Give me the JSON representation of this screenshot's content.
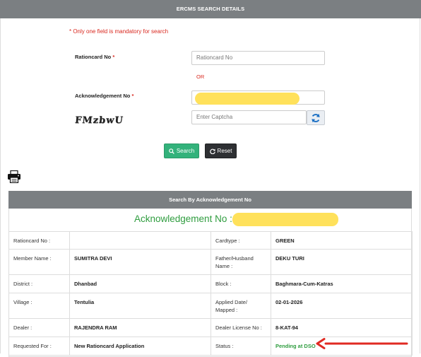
{
  "header": {
    "title": "ERCMS SEARCH DETAILS"
  },
  "form": {
    "mandatory_note": "* Only one field is mandatory for search",
    "rationcard_label": "Rationcard No",
    "rationcard_placeholder": "Rationcard No",
    "or_text": "OR",
    "ack_label": "Acknowledgement No",
    "captcha_text": "FMzbwU",
    "captcha_placeholder": "Enter Captcha",
    "required_mark": "*"
  },
  "buttons": {
    "search_label": "Search",
    "reset_label": "Reset"
  },
  "result": {
    "header": "Search By Acknowledgement No",
    "ack_title": "Acknowledgement No :",
    "rows": [
      {
        "l1": "Rationcard No :",
        "v1": "",
        "l2": "Cardtype :",
        "v2": "GREEN"
      },
      {
        "l1": "Member Name :",
        "v1": "SUMITRA DEVI",
        "l2": "Father/Husband Name :",
        "v2": "DEKU TURI"
      },
      {
        "l1": "District :",
        "v1": "Dhanbad",
        "l2": "Block :",
        "v2": "Baghmara-Cum-Katras"
      },
      {
        "l1": "Village :",
        "v1": "Tentulia",
        "l2": "Applied Date/ Mapped :",
        "v2": "02-01-2026"
      },
      {
        "l1": "Dealer :",
        "v1": "RAJENDRA RAM",
        "l2": "Dealer License No :",
        "v2": "8-KAT-94"
      },
      {
        "l1": "Requested For :",
        "v1": "New Rationcard Application",
        "l2": "Status :",
        "v2": "Pending at DSO"
      }
    ]
  },
  "colors": {
    "header_bg": "#7b7f82",
    "required": "#d9281f",
    "success": "#2f9d3f",
    "search_btn": "#33b27b",
    "reset_btn": "#2e3033",
    "annotation_arrow": "#e02a22",
    "redaction": "#ffe15b"
  }
}
